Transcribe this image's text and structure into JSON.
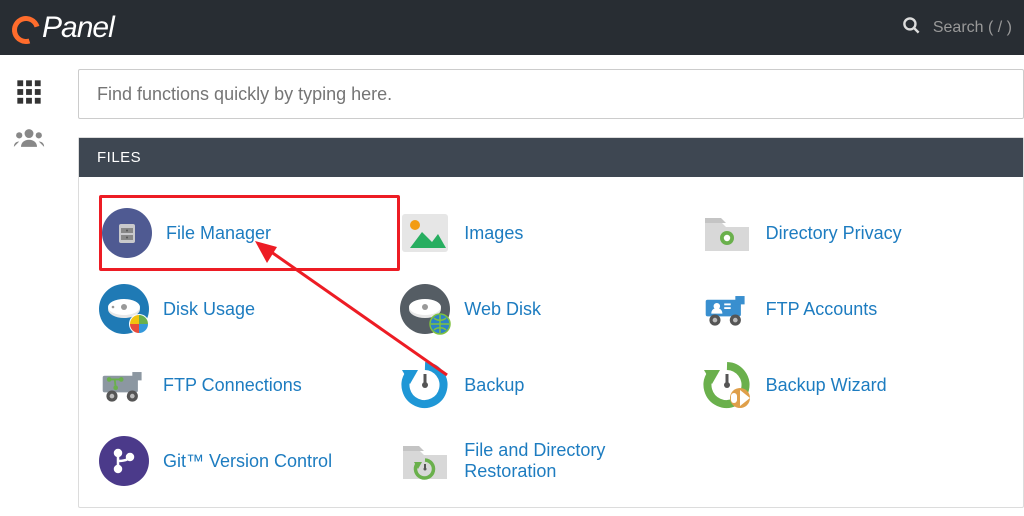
{
  "brand": "Panel",
  "search": {
    "placeholder": "Search ( / )"
  },
  "quick_search": {
    "placeholder": "Find functions quickly by typing here."
  },
  "panel": {
    "title": "FILES",
    "items": [
      {
        "label": "File Manager"
      },
      {
        "label": "Images"
      },
      {
        "label": "Directory Privacy"
      },
      {
        "label": "Disk Usage"
      },
      {
        "label": "Web Disk"
      },
      {
        "label": "FTP Accounts"
      },
      {
        "label": "FTP Connections"
      },
      {
        "label": "Backup"
      },
      {
        "label": "Backup Wizard"
      },
      {
        "label": "Git™ Version Control"
      },
      {
        "label": "File and Directory Restoration"
      }
    ]
  }
}
